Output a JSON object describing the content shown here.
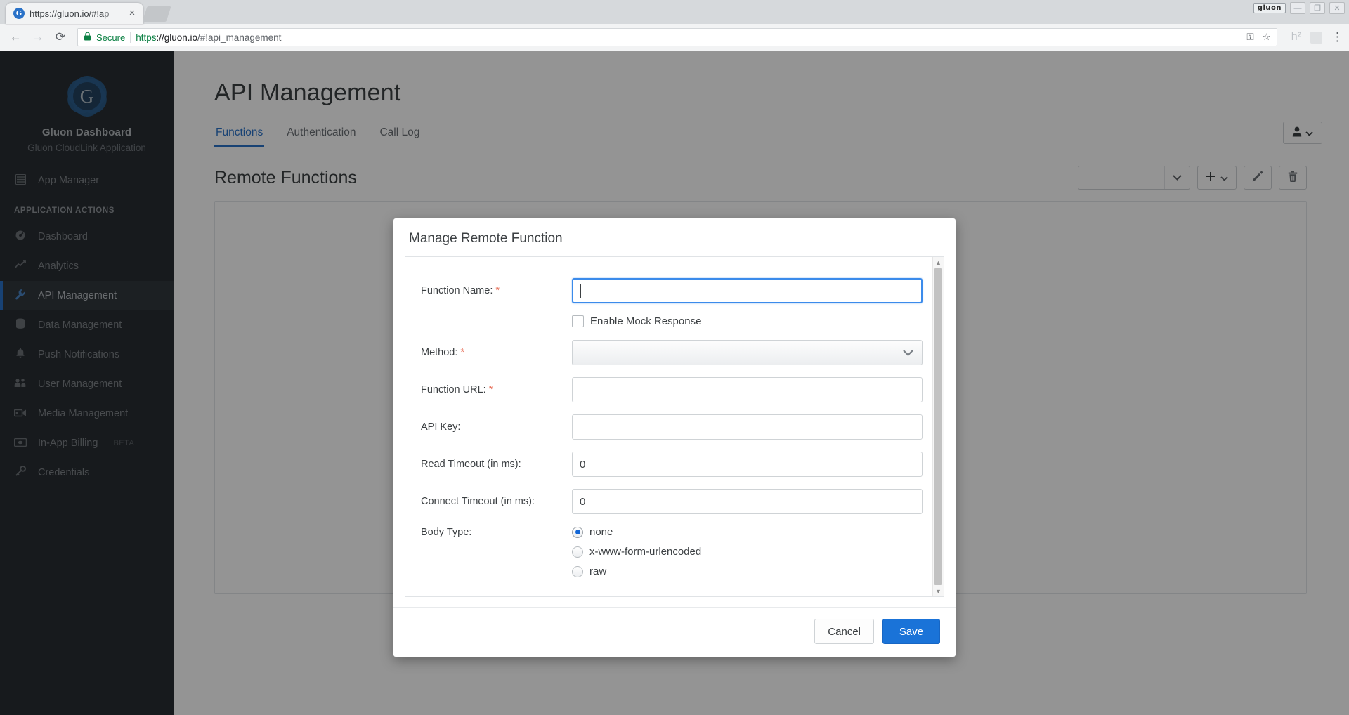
{
  "browser": {
    "tab": {
      "title": "https://gluon.io/#!ap",
      "favicon": "G",
      "close_icon": "×"
    },
    "new_tab_label": "",
    "window": {
      "badge": "gluon",
      "minimize": "—",
      "maximize": "❐",
      "close": "✕"
    },
    "nav": {
      "back_icon": "←",
      "forward_icon": "→",
      "reload_icon": "⟳"
    },
    "omnibox": {
      "lock_icon": "🔒",
      "secure_label": "Secure",
      "url_scheme": "https",
      "url_host": "://gluon.io",
      "url_rest": "/#!api_management"
    },
    "omni_actions": {
      "key_icon": "⚿",
      "star_icon": "☆"
    },
    "extensions": {
      "h2_label": "h²",
      "note_icon": "",
      "menu_icon": "⋮"
    }
  },
  "sidebar": {
    "logo_letter": "G",
    "title": "Gluon Dashboard",
    "subtitle": "Gluon CloudLink Application",
    "top_items": [
      {
        "label": "App Manager",
        "icon": "▤"
      }
    ],
    "section_label": "APPLICATION ACTIONS",
    "items": [
      {
        "label": "Dashboard",
        "icon": "◔",
        "active": false,
        "badge": ""
      },
      {
        "label": "Analytics",
        "icon": "📈",
        "active": false,
        "badge": ""
      },
      {
        "label": "API Management",
        "icon": "🔧",
        "active": true,
        "badge": ""
      },
      {
        "label": "Data Management",
        "icon": "🗄",
        "active": false,
        "badge": ""
      },
      {
        "label": "Push Notifications",
        "icon": "🔔",
        "active": false,
        "badge": ""
      },
      {
        "label": "User Management",
        "icon": "👥",
        "active": false,
        "badge": ""
      },
      {
        "label": "Media Management",
        "icon": "🎥",
        "active": false,
        "badge": ""
      },
      {
        "label": "In-App Billing",
        "icon": "💳",
        "active": false,
        "badge": "BETA"
      },
      {
        "label": "Credentials",
        "icon": "🔑",
        "active": false,
        "badge": ""
      }
    ]
  },
  "main": {
    "page_title": "API Management",
    "user_menu": {
      "avatar_icon": "👤",
      "chevron": "⌄"
    },
    "tabs": [
      {
        "label": "Functions",
        "active": true
      },
      {
        "label": "Authentication",
        "active": false
      },
      {
        "label": "Call Log",
        "active": false
      }
    ],
    "section_title": "Remote Functions",
    "toolbar": {
      "filter_value": "",
      "filter_chevron": "⌄",
      "add_icon": "✚",
      "add_chevron": "⌄",
      "edit_icon": "✏",
      "delete_icon": "🗑"
    }
  },
  "modal": {
    "title": "Manage Remote Function",
    "fields": {
      "function_name": {
        "label": "Function Name:",
        "required": true,
        "value": "",
        "focused": true
      },
      "enable_mock": {
        "label": "Enable Mock Response",
        "checked": false
      },
      "method": {
        "label": "Method:",
        "required": true,
        "value": "",
        "chevron": "⌄"
      },
      "function_url": {
        "label": "Function URL:",
        "required": true,
        "value": ""
      },
      "api_key": {
        "label": "API Key:",
        "required": false,
        "value": ""
      },
      "read_timeout": {
        "label": "Read Timeout (in ms):",
        "required": false,
        "value": "0"
      },
      "connect_timeout": {
        "label": "Connect Timeout (in ms):",
        "required": false,
        "value": "0"
      },
      "body_type": {
        "label": "Body Type:",
        "options": [
          {
            "label": "none",
            "selected": true
          },
          {
            "label": "x-www-form-urlencoded",
            "selected": false
          },
          {
            "label": "raw",
            "selected": false
          }
        ]
      }
    },
    "required_marker": "*",
    "scrollbar": {
      "up_arrow": "▲",
      "down_arrow": "▼"
    },
    "buttons": {
      "cancel": "Cancel",
      "save": "Save"
    }
  },
  "colors": {
    "accent": "#2a72c8",
    "sidebar_bg": "#282d32",
    "save_button": "#1a73d8",
    "required": "#e8705a",
    "secure_green": "#0b8043"
  }
}
